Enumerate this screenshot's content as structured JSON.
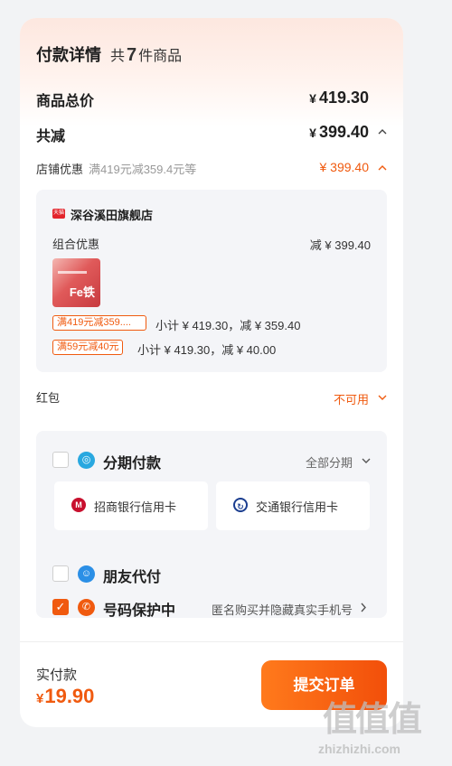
{
  "header": {
    "title": "付款详情",
    "count_prefix": "共",
    "count": "7",
    "count_suffix": "件商品"
  },
  "summary": {
    "total_label": "商品总价",
    "total_currency": "¥",
    "total_value": "419.30",
    "discount_label": "共减",
    "discount_currency": "¥",
    "discount_value": "399.40"
  },
  "shop_discount": {
    "label": "店铺优惠",
    "detail": "满419元减359.4元等",
    "amount": "¥ 399.40"
  },
  "store": {
    "badge": "天猫",
    "name": "深谷溪田旗舰店",
    "combo_label": "组合优惠",
    "combo_amount": "减 ¥ 399.40",
    "product_label": "Fe铁",
    "promos": [
      {
        "tag": "满419元减359....",
        "subtotal": "小计 ¥ 419.30，减 ¥ 359.40"
      },
      {
        "tag": "满59元减40元",
        "subtotal": "小计 ¥ 419.30，减 ¥ 40.00"
      }
    ]
  },
  "red_packet": {
    "label": "红包",
    "status": "不可用"
  },
  "payment": {
    "installment": {
      "label": "分期付款",
      "option": "全部分期",
      "icon": "installment-icon",
      "checked": false
    },
    "banks": [
      {
        "name": "招商银行信用卡",
        "icon": "cmb-bank-icon"
      },
      {
        "name": "交通银行信用卡",
        "icon": "bocom-bank-icon"
      }
    ],
    "friend_pay": {
      "label": "朋友代付",
      "icon": "friend-pay-icon",
      "checked": false
    },
    "number_protect": {
      "label": "号码保护中",
      "desc": "匿名购买并隐藏真实手机号",
      "icon": "phone-shield-icon",
      "checked": true
    }
  },
  "footer": {
    "paid_label": "实付款",
    "paid_currency": "¥",
    "paid_value": "19.90",
    "submit_label": "提交订单"
  },
  "watermark": {
    "big": "值值值",
    "small": "zhizhizhi.com"
  },
  "colors": {
    "accent": "#f05a0f",
    "panel": "#f4f5f8",
    "page_bg": "#f2f3f5"
  }
}
